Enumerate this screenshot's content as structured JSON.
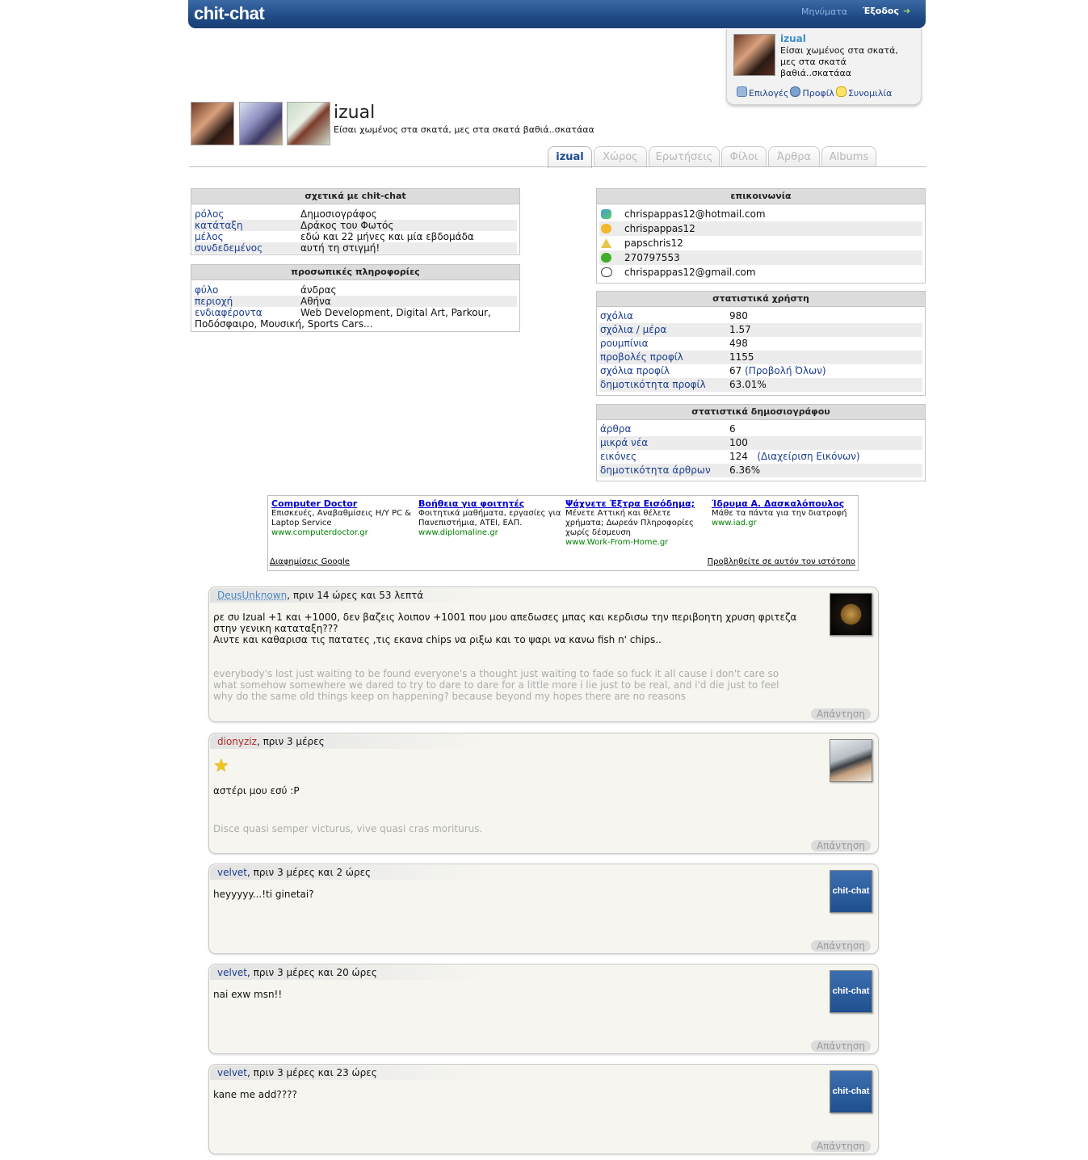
{
  "header": {
    "logo": "chit-chat",
    "nav_messages": "Μηνύματα",
    "nav_logout": "Έξοδος"
  },
  "userbox": {
    "name": "izual",
    "status": "Είσαι χωμένος στα σκατά, μες στα σκατά βαθιά..σκατάαα",
    "links": [
      "Επιλογές",
      "Προφίλ",
      "Συνομιλία"
    ]
  },
  "profile": {
    "name": "izual",
    "status": "Είσαι χωμένος στα σκατά, μες στα σκατά βαθιά..σκατάαα",
    "tabs": [
      "izual",
      "Χώρος",
      "Ερωτήσεις",
      "Φίλοι",
      "Άρθρα",
      "Albums"
    ]
  },
  "about": {
    "title": "σχετικά με chit-chat",
    "rows": [
      {
        "k": "ρόλος",
        "v": "Δημοσιογράφος"
      },
      {
        "k": "κατάταξη",
        "v": "Δράκος του Φωτός"
      },
      {
        "k": "μέλος",
        "v": "εδώ και 22 μήνες και μία εβδομάδα"
      },
      {
        "k": "συνδεδεμένος",
        "v": "αυτή τη στιγμή!"
      }
    ]
  },
  "personal": {
    "title": "προσωπικές πληροφορίες",
    "rows": [
      {
        "k": "φύλο",
        "v": "άνδρας"
      },
      {
        "k": "περιοχή",
        "v": "Αθήνα"
      },
      {
        "k": "ενδιαφέροντα",
        "v": "Web Development, Digital Art, Parkour,"
      }
    ],
    "interests_cont": "Ποδόσφαιρο, Μουσική, Sports Cars..."
  },
  "contact": {
    "title": "επικοινωνία",
    "rows": [
      {
        "icon": "msn-icon",
        "v": "chrispappas12@hotmail.com"
      },
      {
        "icon": "yahoo-icon",
        "v": "chrispappas12"
      },
      {
        "icon": "aim-icon",
        "v": "papschris12"
      },
      {
        "icon": "icq-icon",
        "v": "270797553"
      },
      {
        "icon": "gtalk-icon",
        "v": "chrispappas12@gmail.com"
      }
    ]
  },
  "stats": {
    "title": "στατιστικά χρήστη",
    "rows": [
      {
        "k": "σχόλια",
        "v": "980"
      },
      {
        "k": "σχόλια / μέρα",
        "v": "1.57"
      },
      {
        "k": "ρουμπίνια",
        "v": "498"
      },
      {
        "k": "προβολές προφίλ",
        "v": "1155"
      },
      {
        "k": "σχόλια προφίλ",
        "v": "67",
        "link": "(Προβολή Όλων)"
      },
      {
        "k": "δημοτικότητα προφίλ",
        "v": "63.01%"
      }
    ]
  },
  "journo": {
    "title": "στατιστικά δημοσιογράφου",
    "rows": [
      {
        "k": "άρθρα",
        "v": "6"
      },
      {
        "k": "μικρά νέα",
        "v": "100"
      },
      {
        "k": "εικόνες",
        "v": "124",
        "link": "(Διαχείριση Εικόνων)"
      },
      {
        "k": "δημοτικότητα άρθρων",
        "v": "6.36%"
      }
    ]
  },
  "ads": {
    "items": [
      {
        "title": "Computer Doctor",
        "text": "Επισκευές, Αναβαθμίσεις Η/Υ PC & Laptop Service",
        "url": "www.computerdoctor.gr"
      },
      {
        "title": "Βοήθεια για φοιτητές",
        "text": "Φοιτητικά μαθήματα, εργασίες για Πανεπιστήμια, ΑΤΕΙ, ΕΑΠ.",
        "url": "www.diplomaline.gr"
      },
      {
        "title": "Ψάχνετε Έξτρα Εισόδημα;",
        "text": "Μένετε Αττική και θέλετε χρήματα; Δωρεάν Πληροφορίες χωρίς δέσμευση",
        "url": "www.Work-From-Home.gr"
      },
      {
        "title": "Ίδρυμα Α. Δασκαλόπουλος",
        "text": "Μάθε τα πάντα για την διατροφή",
        "url": "www.iad.gr"
      }
    ],
    "google": "Διαφημίσεις Google",
    "advertise": "Προβληθείτε σε αυτόν τον ιστότοπο"
  },
  "comments": [
    {
      "user": "DeusUnknown",
      "time": ", πριν 14 ώρες και 53 λεπτά",
      "body": [
        "ρε συ Izual +1 και +1000, δεν βαζεις λοιπον +1001 που μου απεδωσες μπας και κερδισω την περιβοητη χρυση φριτεζα",
        "στην γενικη καταταξη???",
        "Αιντε και καθαρισα τις πατατες ,τις εκανα chips να ριξω και το ψαρι να κανω fish n' chips.."
      ],
      "signature": [
        "everybody's lost just waiting to be found everyone's a thought just waiting to fade so fuck it all cause i don't care so",
        "what somehow somewhere we dared to try to dare to dare for a little more i lie just to be real, and i'd die just to feel",
        "why do the same old things keep on happening? because beyond my hopes there are no reasons"
      ],
      "reply": "Απάντηση"
    },
    {
      "user": "dionyziz",
      "time": ", πριν 3 μέρες",
      "body": [
        "αστέρι μου εσύ :P"
      ],
      "signature": [
        "Disce quasi semper victurus, vive quasi cras moriturus."
      ],
      "reply": "Απάντηση"
    },
    {
      "user": "velvet",
      "time": ", πριν 3 μέρες και 2 ώρες",
      "body": [
        "heyyyyy...!ti ginetai?"
      ],
      "avatar": "chit-chat",
      "reply": "Απάντηση"
    },
    {
      "user": "velvet",
      "time": ", πριν 3 μέρες και 20 ώρες",
      "body": [
        "nai exw msn!!"
      ],
      "avatar": "chit-chat",
      "reply": "Απάντηση"
    },
    {
      "user": "velvet",
      "time": ", πριν 3 μέρες και 23 ώρες",
      "body": [
        "kane me add????"
      ],
      "avatar": "chit-chat",
      "reply": "Απάντηση"
    }
  ]
}
